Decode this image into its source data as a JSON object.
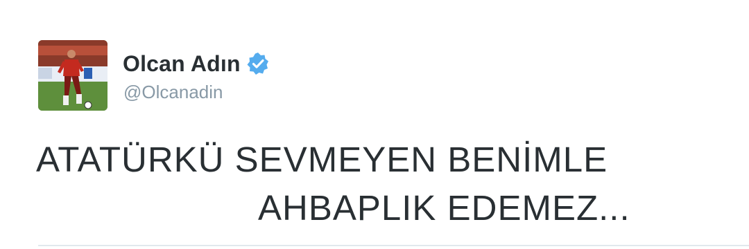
{
  "tweet": {
    "author": {
      "display_name": "Olcan Adın",
      "handle": "@Olcanadin",
      "verified": true,
      "avatar_icon": "player-photo-avatar"
    },
    "text_lines": [
      "ATATÜRKÜ SEVMEYEN BENİMLE",
      "AHBAPLIK EDEMEZ..."
    ]
  },
  "colors": {
    "name": "#292f33",
    "handle": "#8899a6",
    "verified_badge": "#55acee",
    "text": "#292f33",
    "divider": "#e1e8ed"
  }
}
